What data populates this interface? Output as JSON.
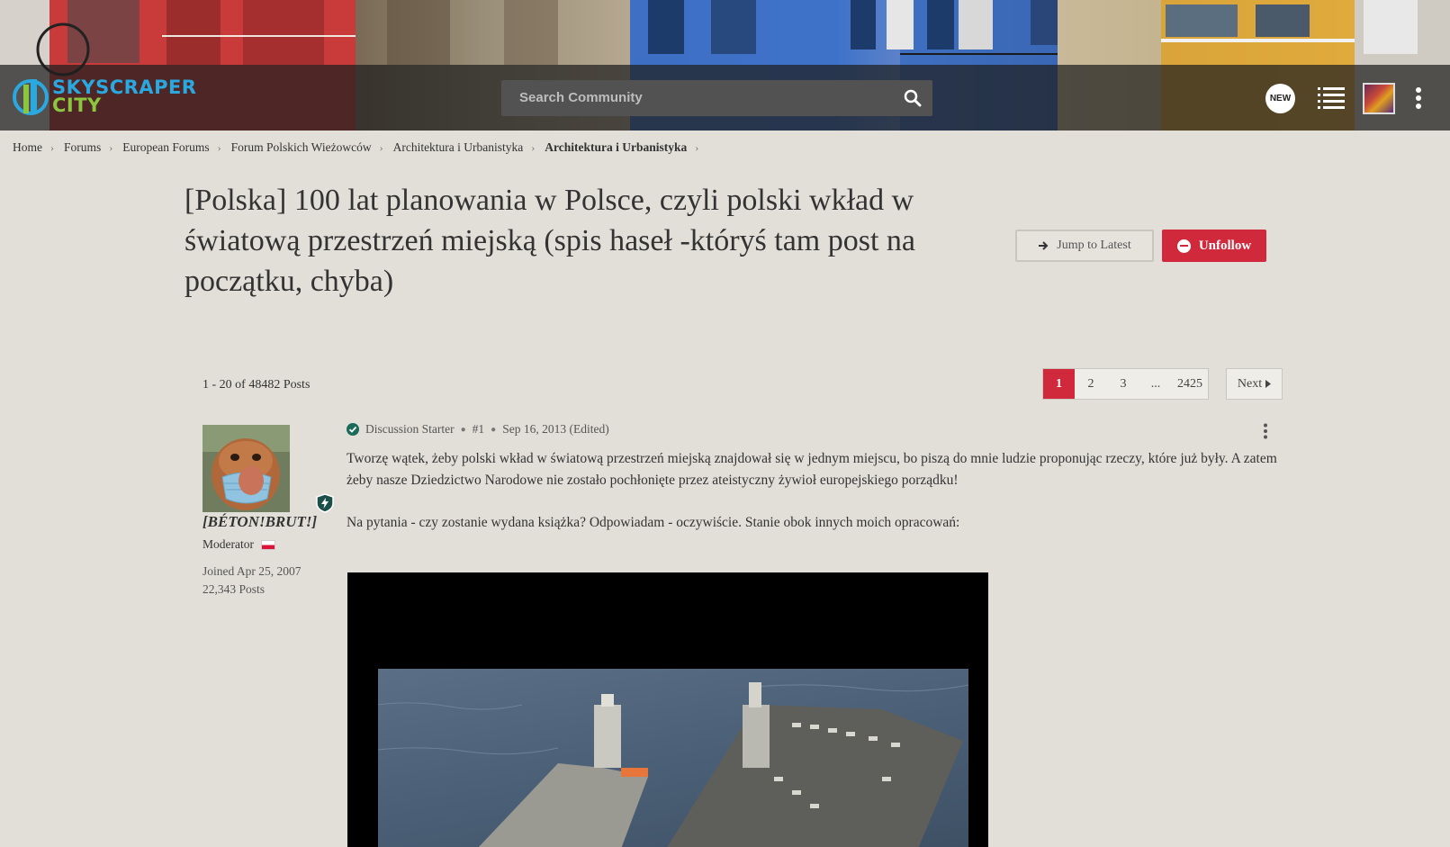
{
  "header": {
    "logo_line1": "SKYSCRAPER",
    "logo_line2": "CITY",
    "search_placeholder": "Search Community",
    "new_badge": "NEW"
  },
  "breadcrumb": [
    "Home",
    "Forums",
    "European Forums",
    "Forum Polskich Wieżowców",
    "Architektura i Urbanistyka",
    "Architektura i Urbanistyka"
  ],
  "thread": {
    "title": "[Polska] 100 lat planowania w Polsce, czyli polski wkład w światową przestrzeń miejską (spis haseł -któryś tam post na początku, chyba)",
    "jump_label": "Jump to Latest",
    "unfollow_label": "Unfollow",
    "post_count": "1 - 20 of 48482 Posts"
  },
  "pagination": {
    "pages": [
      "1",
      "2",
      "3",
      "...",
      "2425"
    ],
    "current": "1",
    "next_label": "Next"
  },
  "post": {
    "author": {
      "name": "[BÉTON!BRUT!]",
      "role": "Moderator",
      "joined": "Joined Apr 25, 2007",
      "posts": "22,343 Posts"
    },
    "starter_label": "Discussion Starter",
    "number": "#1",
    "date": "Sep 16, 2013 (Edited)",
    "paragraph1": "Tworzę wątek, żeby polski wkład w światową przestrzeń miejską znajdował się w jednym miejscu, bo piszą do mnie ludzie proponując rzeczy, które już były. A zatem żeby nasze Dziedzictwo Narodowe nie zostało pochłonięte przez ateistyczny żywioł europejskiego porządku!",
    "paragraph2": "Na pytania - czy zostanie wydana książka? Odpowiadam - oczywiście. Stanie obok innych moich opracowań:"
  },
  "colors": {
    "accent": "#d0293b",
    "background": "#e2dfd8",
    "verified": "#1a6b5a"
  }
}
